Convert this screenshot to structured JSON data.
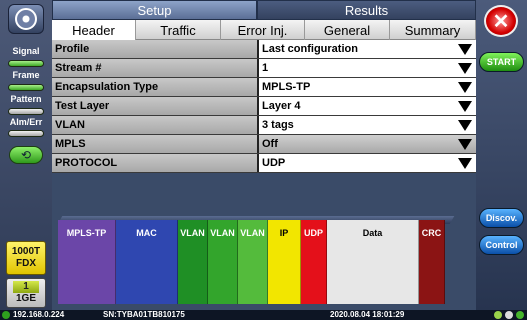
{
  "sidebar": {
    "labels": [
      "Signal",
      "Frame",
      "Pattern",
      "Alm/Err"
    ],
    "rate": [
      "1000T",
      "FDX"
    ],
    "port_number": "1",
    "port_rate": "1GE"
  },
  "top_tabs": [
    "Setup",
    "Results"
  ],
  "sub_tabs": [
    "Header",
    "Traffic",
    "Error Inj.",
    "General",
    "Summary"
  ],
  "rows": [
    {
      "label": "Profile",
      "value": "Last configuration"
    },
    {
      "label": "Stream #",
      "value": "1"
    },
    {
      "label": "Encapsulation Type",
      "value": "MPLS-TP"
    },
    {
      "label": "Test Layer",
      "value": "Layer 4"
    },
    {
      "label": "VLAN",
      "value": "3 tags"
    },
    {
      "label": "MPLS",
      "value": "Off"
    },
    {
      "label": "PROTOCOL",
      "value": "UDP"
    }
  ],
  "frame_fields": [
    {
      "label": "MPLS-TP",
      "color": "#6b46a8"
    },
    {
      "label": "MAC",
      "color": "#2f47b0"
    },
    {
      "label": "VLAN",
      "color": "#1f8f25"
    },
    {
      "label": "VLAN",
      "color": "#33a52c"
    },
    {
      "label": "VLAN",
      "color": "#54bb3c"
    },
    {
      "label": "IP",
      "color": "#f2e600"
    },
    {
      "label": "UDP",
      "color": "#e4101a"
    },
    {
      "label": "Data",
      "color": "#e7e7e7"
    },
    {
      "label": "CRC",
      "color": "#8b1414"
    }
  ],
  "right_buttons": {
    "close": "✕",
    "start": "START",
    "discov": "Discov.",
    "control": "Control"
  },
  "status": {
    "ip": "192.168.0.224",
    "serial": "SN:TYBA01TB810175",
    "datetime": "2020.08.04  18:01:29"
  }
}
